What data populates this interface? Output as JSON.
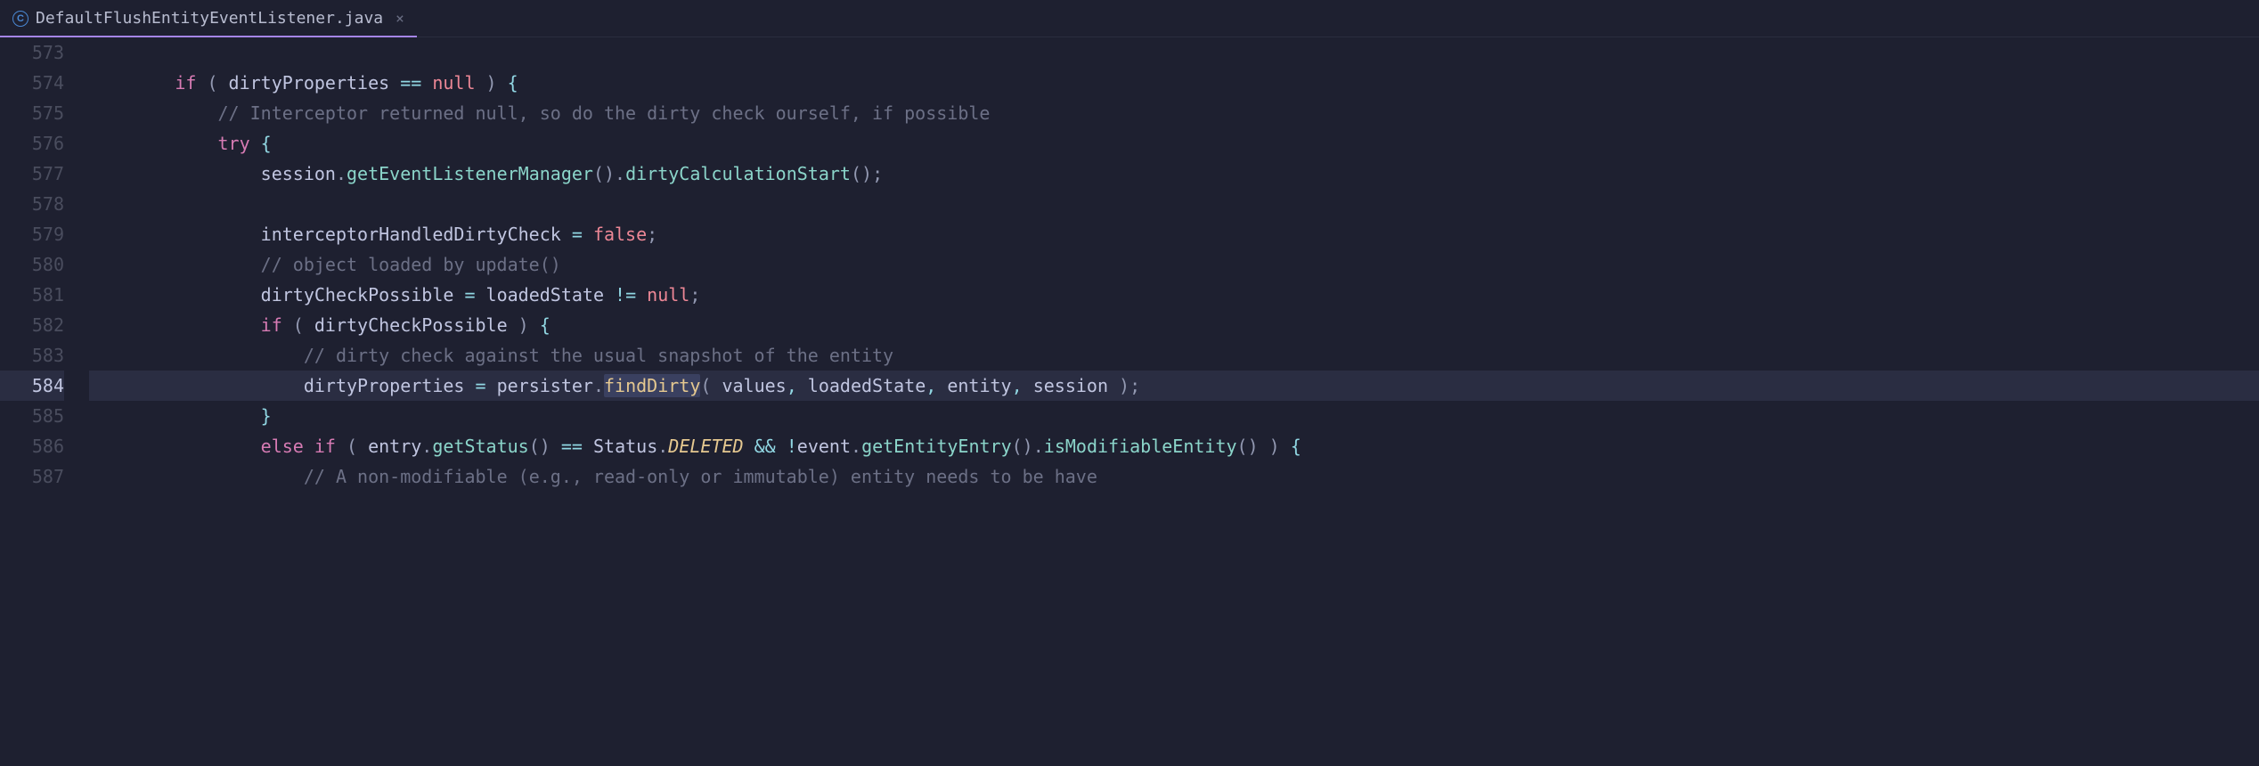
{
  "tab": {
    "filename": "DefaultFlushEntityEventListener.java",
    "icon_letter": "C"
  },
  "gutter": {
    "lines": [
      "573",
      "574",
      "575",
      "576",
      "577",
      "578",
      "579",
      "580",
      "581",
      "582",
      "583",
      "584",
      "585",
      "586",
      "587"
    ],
    "current": "584"
  },
  "code": {
    "573": {
      "text": ""
    },
    "574": {
      "indent": "        ",
      "tokens": {
        "t0": "if",
        "t1": " ( ",
        "t2": "dirtyProperties",
        "t3": " == ",
        "t4": "null",
        "t5": " )",
        "t6": " {"
      }
    },
    "575": {
      "indent": "            ",
      "tokens": {
        "t0": "// Interceptor returned null, so do the dirty check ourself, if possible"
      }
    },
    "576": {
      "indent": "            ",
      "tokens": {
        "t0": "try",
        "t1": " {"
      }
    },
    "577": {
      "indent": "                ",
      "tokens": {
        "t0": "session",
        "t1": ".",
        "t2": "getEventListenerManager",
        "t3": "()",
        "t4": ".",
        "t5": "dirtyCalculationStart",
        "t6": "()",
        "t7": ";"
      }
    },
    "578": {
      "text": ""
    },
    "579": {
      "indent": "                ",
      "tokens": {
        "t0": "interceptorHandledDirtyCheck",
        "t1": " = ",
        "t2": "false",
        "t3": ";"
      }
    },
    "580": {
      "indent": "                ",
      "tokens": {
        "t0": "// object loaded by update()"
      }
    },
    "581": {
      "indent": "                ",
      "tokens": {
        "t0": "dirtyCheckPossible",
        "t1": " = ",
        "t2": "loadedState",
        "t3": " != ",
        "t4": "null",
        "t5": ";"
      }
    },
    "582": {
      "indent": "                ",
      "tokens": {
        "t0": "if",
        "t1": " ( ",
        "t2": "dirtyCheckPossible",
        "t3": " )",
        "t4": " {"
      }
    },
    "583": {
      "indent": "                    ",
      "tokens": {
        "t0": "// dirty check against the usual snapshot of the entity"
      }
    },
    "584": {
      "indent": "                    ",
      "tokens": {
        "t0": "dirtyProperties",
        "t1": " = ",
        "t2": "persister",
        "t3": ".",
        "t4": "findDirty",
        "t5": "(",
        "t6": " values",
        "t7": ",",
        "t8": " loadedState",
        "t9": ",",
        "t10": " entity",
        "t11": ",",
        "t12": " session ",
        "t13": ")",
        "t14": ";"
      }
    },
    "585": {
      "indent": "                ",
      "tokens": {
        "t0": "}"
      }
    },
    "586": {
      "indent": "                ",
      "tokens": {
        "t0": "else if",
        "t1": " ( ",
        "t2": "entry",
        "t3": ".",
        "t4": "getStatus",
        "t5": "()",
        "t6": " == ",
        "t7": "Status",
        "t8": ".",
        "t9": "DELETED",
        "t10": " && ",
        "t11": "!",
        "t12": "event",
        "t13": ".",
        "t14": "getEntityEntry",
        "t15": "()",
        "t16": ".",
        "t17": "isModifiableEntity",
        "t18": "()",
        "t19": " )",
        "t20": " {"
      }
    },
    "587": {
      "indent": "                    ",
      "tokens": {
        "t0": "// A non-modifiable (e.g., read-only or immutable) entity needs to be have"
      }
    }
  }
}
